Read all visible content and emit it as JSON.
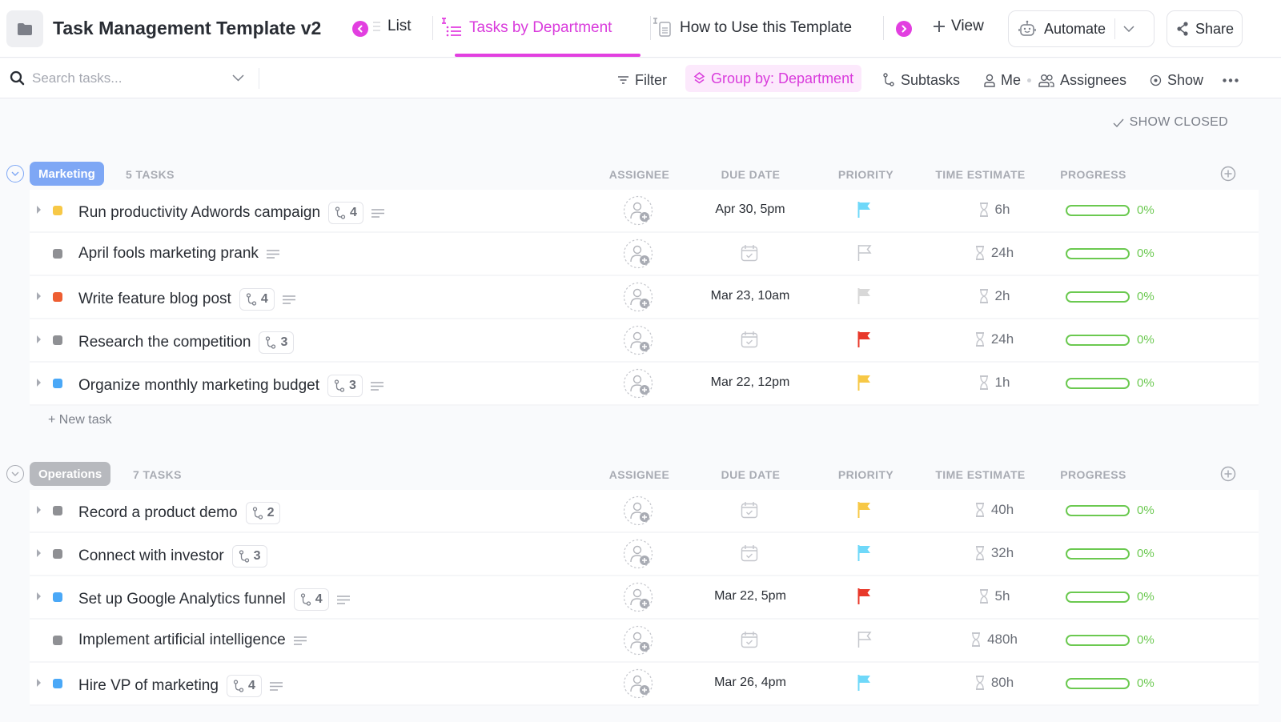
{
  "header": {
    "title": "Task Management Template v2",
    "tabs": [
      {
        "label": "List",
        "active": false
      },
      {
        "label": "Tasks by Department",
        "active": true
      },
      {
        "label": "How to Use this Template",
        "active": false
      }
    ],
    "add_view_label": "View",
    "automate_label": "Automate",
    "share_label": "Share",
    "accent_color": "#e23fe0"
  },
  "toolbar": {
    "search_placeholder": "Search tasks...",
    "filter_label": "Filter",
    "group_by_label": "Group by: Department",
    "subtasks_label": "Subtasks",
    "me_label": "Me",
    "assignees_label": "Assignees",
    "show_label": "Show"
  },
  "show_closed_label": "SHOW CLOSED",
  "columns": {
    "assignee": "ASSIGNEE",
    "due_date": "DUE DATE",
    "priority": "PRIORITY",
    "time_estimate": "TIME ESTIMATE",
    "progress": "PROGRESS"
  },
  "new_task_label": "+ New task",
  "groups": [
    {
      "name": "Marketing",
      "count_label": "5 TASKS",
      "color": "#7ea7f5",
      "tasks": [
        {
          "name": "Run productivity Adwords campaign",
          "status_color": "#f7c846",
          "expandable": true,
          "subtasks": "4",
          "has_description": true,
          "due": "Apr 30, 5pm",
          "priority": "normal",
          "priority_color": "#6fd8f9",
          "time": "6h",
          "progress": 0,
          "progress_label": "0%"
        },
        {
          "name": "April fools marketing prank",
          "status_color": "#8f9094",
          "expandable": false,
          "subtasks": "",
          "has_description": true,
          "due": "",
          "priority": "none",
          "priority_color": "#c4c6cc",
          "time": "24h",
          "progress": 0,
          "progress_label": "0%"
        },
        {
          "name": "Write feature blog post",
          "status_color": "#ee5e32",
          "expandable": true,
          "subtasks": "4",
          "has_description": true,
          "due": "Mar 23, 10am",
          "priority": "low",
          "priority_color": "#d8d8d8",
          "time": "2h",
          "progress": 0,
          "progress_label": "0%"
        },
        {
          "name": "Research the competition",
          "status_color": "#8f9094",
          "expandable": true,
          "subtasks": "3",
          "has_description": false,
          "due": "",
          "priority": "urgent",
          "priority_color": "#e8382a",
          "time": "24h",
          "progress": 0,
          "progress_label": "0%"
        },
        {
          "name": "Organize monthly marketing budget",
          "status_color": "#4aa8f7",
          "expandable": true,
          "subtasks": "3",
          "has_description": true,
          "due": "Mar 22, 12pm",
          "priority": "high",
          "priority_color": "#f7c846",
          "time": "1h",
          "progress": 0,
          "progress_label": "0%"
        }
      ]
    },
    {
      "name": "Operations",
      "count_label": "7 TASKS",
      "color": "#b7b9be",
      "tasks": [
        {
          "name": "Record a product demo",
          "status_color": "#8f9094",
          "expandable": true,
          "subtasks": "2",
          "has_description": false,
          "due": "",
          "priority": "high",
          "priority_color": "#f7c846",
          "time": "40h",
          "progress": 0,
          "progress_label": "0%"
        },
        {
          "name": "Connect with investor",
          "status_color": "#8f9094",
          "expandable": true,
          "subtasks": "3",
          "has_description": false,
          "due": "",
          "priority": "normal",
          "priority_color": "#6fd8f9",
          "time": "32h",
          "progress": 0,
          "progress_label": "0%"
        },
        {
          "name": "Set up Google Analytics funnel",
          "status_color": "#4aa8f7",
          "expandable": true,
          "subtasks": "4",
          "has_description": true,
          "due": "Mar 22, 5pm",
          "priority": "urgent",
          "priority_color": "#e8382a",
          "time": "5h",
          "progress": 0,
          "progress_label": "0%"
        },
        {
          "name": "Implement artificial intelligence",
          "status_color": "#8f9094",
          "expandable": false,
          "subtasks": "",
          "has_description": true,
          "due": "",
          "priority": "none",
          "priority_color": "#c4c6cc",
          "time": "480h",
          "progress": 0,
          "progress_label": "0%"
        },
        {
          "name": "Hire VP of marketing",
          "status_color": "#4aa8f7",
          "expandable": true,
          "subtasks": "4",
          "has_description": true,
          "due": "Mar 26, 4pm",
          "priority": "normal",
          "priority_color": "#6fd8f9",
          "time": "80h",
          "progress": 0,
          "progress_label": "0%"
        }
      ]
    }
  ]
}
